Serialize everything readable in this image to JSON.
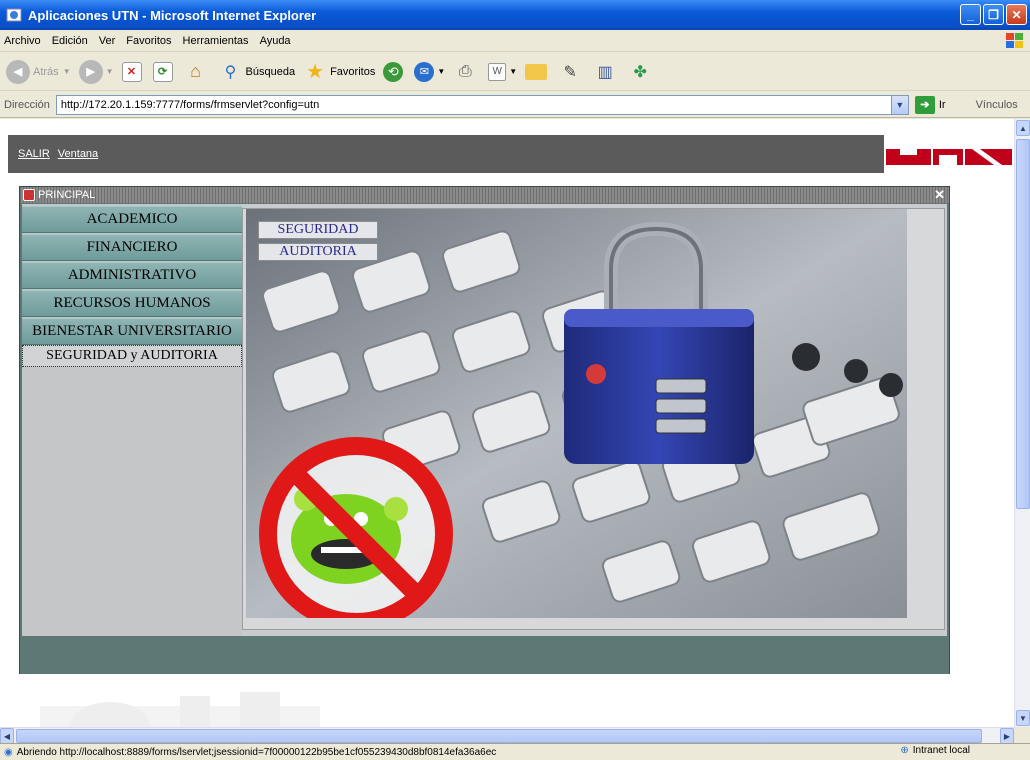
{
  "window": {
    "title": "Aplicaciones UTN - Microsoft Internet Explorer",
    "buttons": [
      "minimize",
      "maximize",
      "close"
    ]
  },
  "menubar": {
    "items": [
      "Archivo",
      "Edición",
      "Ver",
      "Favoritos",
      "Herramientas",
      "Ayuda"
    ]
  },
  "toolbar": {
    "back_label": "Atrás",
    "search_label": "Búsqueda",
    "favorites_label": "Favoritos"
  },
  "address": {
    "label": "Dirección",
    "url": "http://172.20.1.159:7777/forms/frmservlet?config=utn",
    "go_label": "Ir",
    "links_label": "Vínculos"
  },
  "app": {
    "menu": {
      "salir": "SALIR",
      "ventana": "Ventana"
    },
    "logo_colors": [
      "#c0001a",
      "#ffffff"
    ],
    "principal": {
      "title": "PRINCIPAL",
      "nav": [
        {
          "label": "ACADEMICO",
          "active": false
        },
        {
          "label": "FINANCIERO",
          "active": false
        },
        {
          "label": "ADMINISTRATIVO",
          "active": false
        },
        {
          "label": "RECURSOS HUMANOS",
          "active": false
        },
        {
          "label": "BIENESTAR UNIVERSITARIO",
          "active": false
        },
        {
          "label": "SEGURIDAD y AUDITORIA",
          "active": true
        }
      ],
      "subbuttons": [
        "SEGURIDAD",
        "AUDITORIA"
      ]
    }
  },
  "status": {
    "text": "Abriendo http://localhost:8889/forms/lservlet;jsessionid=7f00000122b95be1cf055239430d8bf0814efa36a6ec",
    "zone": "Intranet local"
  }
}
